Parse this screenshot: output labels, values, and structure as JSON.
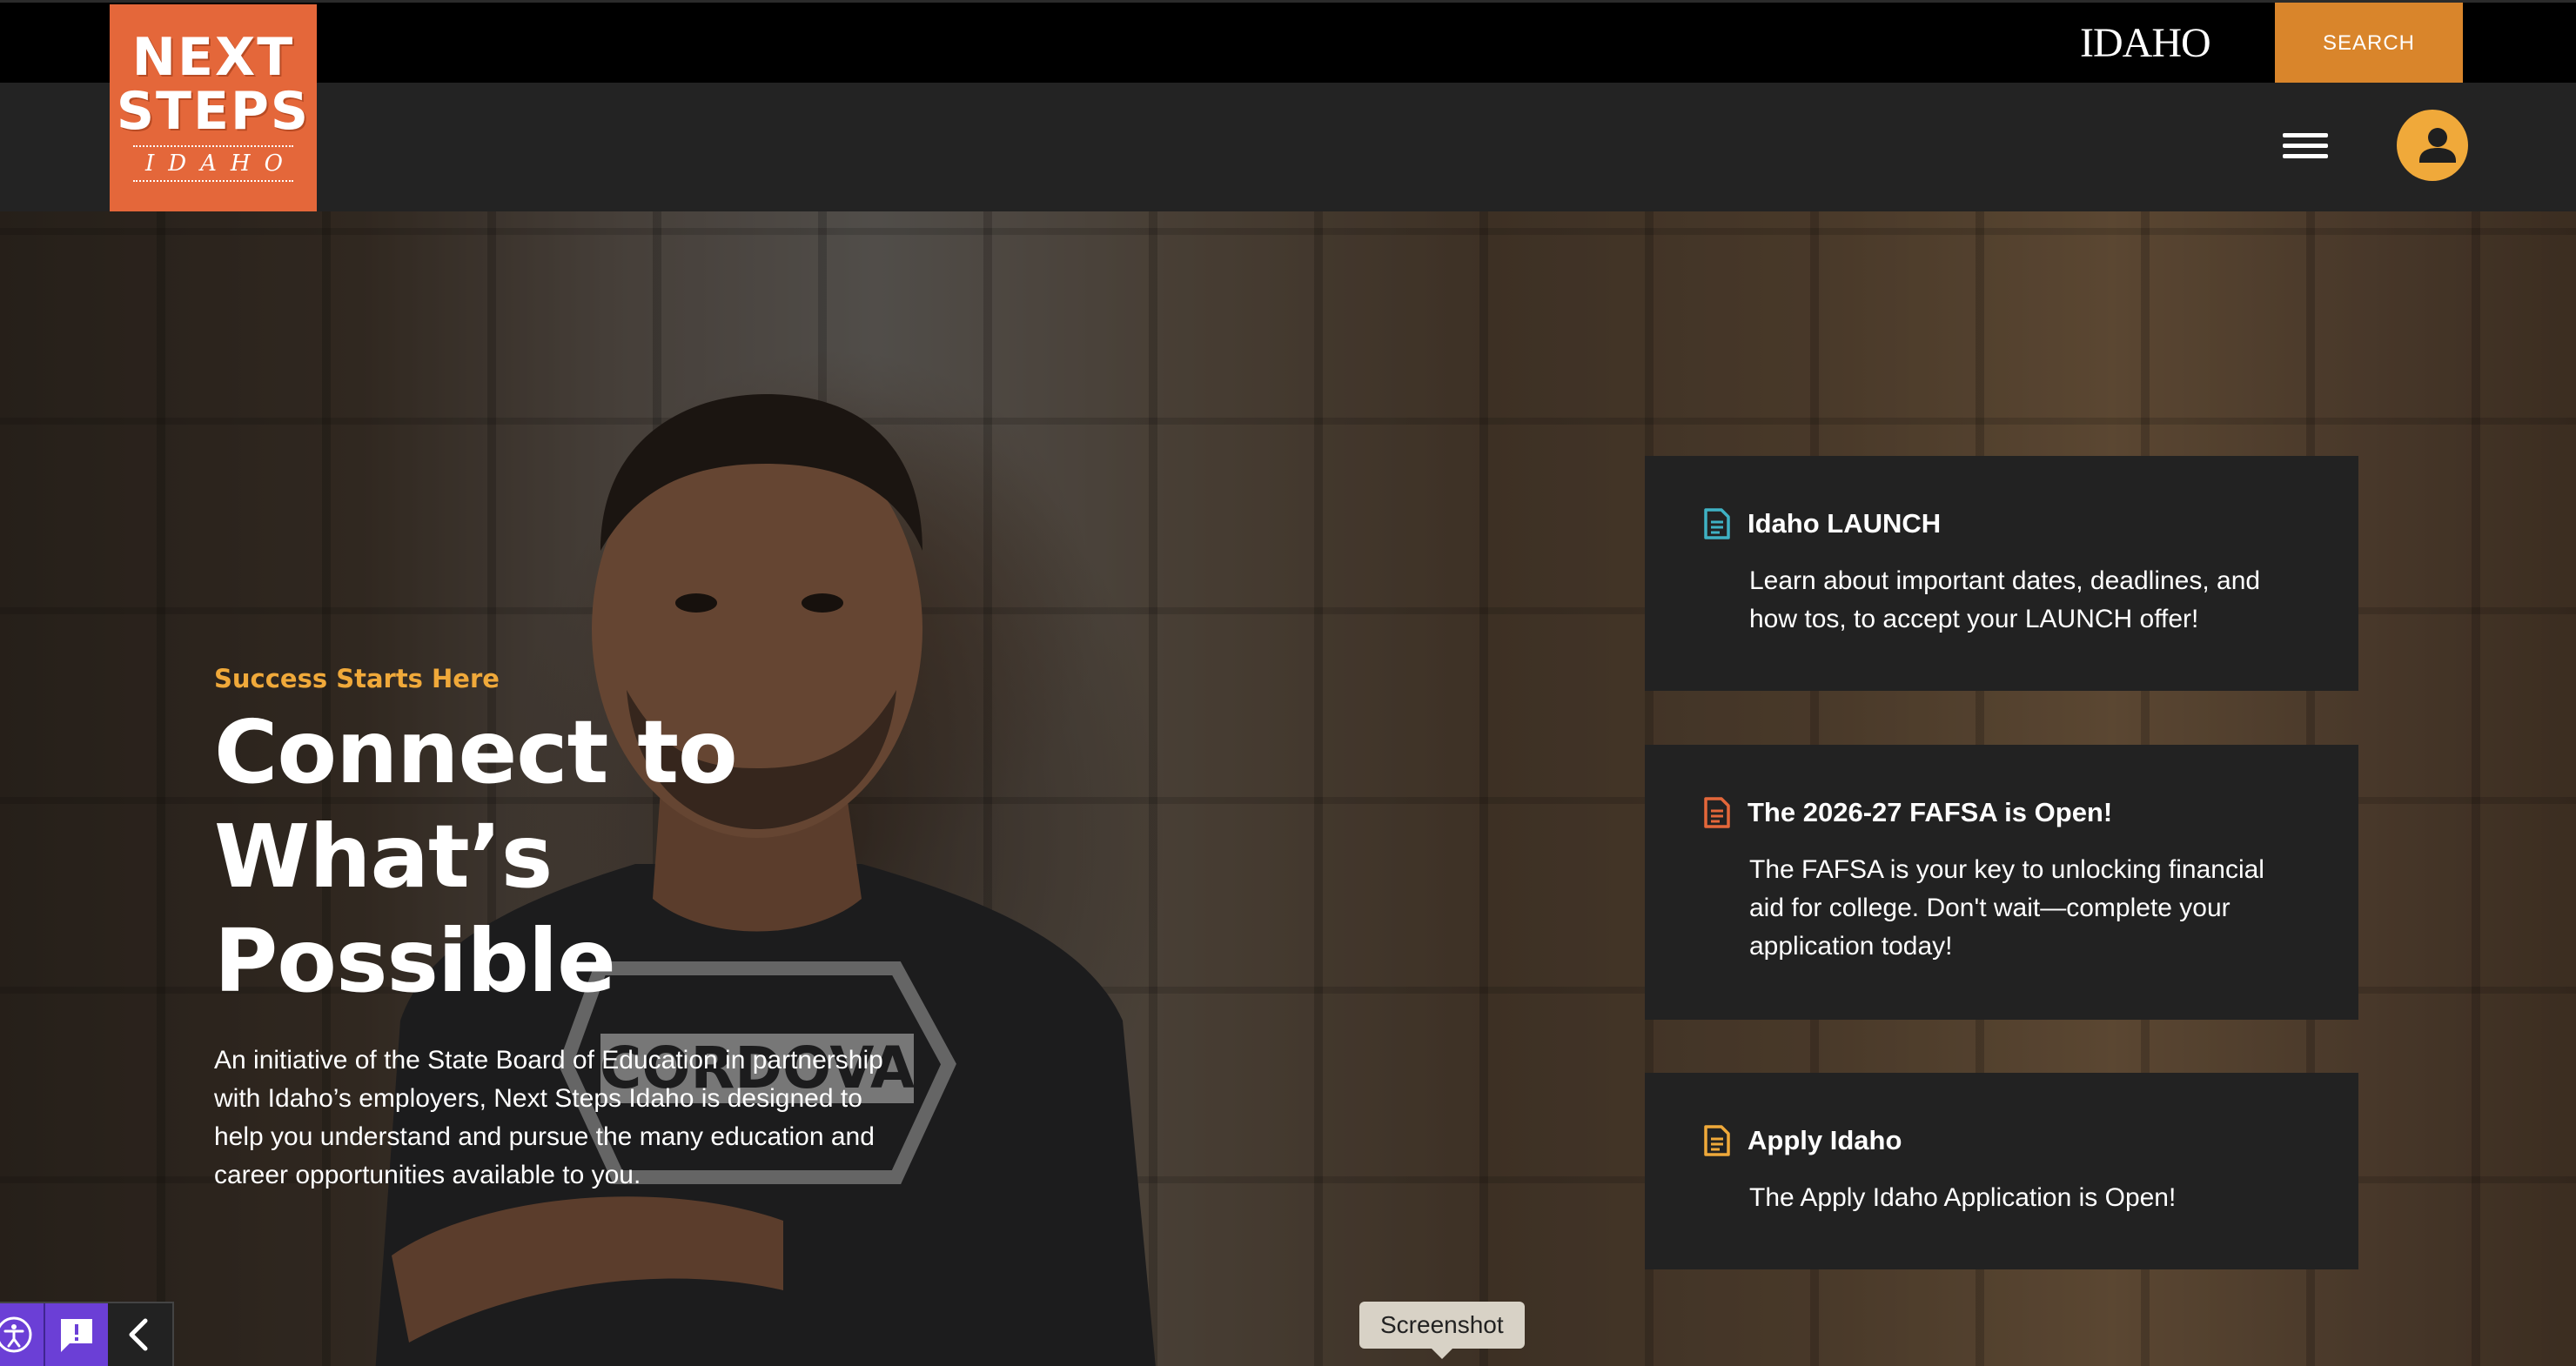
{
  "utility_bar": {
    "state_wordmark": "IDAHO",
    "search_label": "SEARCH"
  },
  "logo": {
    "line1": "NEXT",
    "line2": "STEPS",
    "line3": "IDAHO"
  },
  "hero": {
    "eyebrow": "Success Starts Here",
    "headline_line1": "Connect to",
    "headline_line2": "What’s Possible",
    "intro": "An initiative of the State Board of Education in partnership with Idaho’s employers, Next Steps Idaho is designed to help you understand and pursue the many education and career opportunities available to you."
  },
  "cards": [
    {
      "title": "Idaho LAUNCH",
      "body": "Learn about important dates, deadlines, and how tos, to accept your LAUNCH offer!",
      "icon": "document-icon",
      "icon_color": "#3fb2c4"
    },
    {
      "title": "The 2026-27 FAFSA is Open!",
      "body": "The FAFSA is your key to unlocking financial aid for college. Don't wait—complete your application today!",
      "icon": "document-icon",
      "icon_color": "#e4673a"
    },
    {
      "title": "Apply Idaho",
      "body": "The Apply Idaho Application is Open!",
      "icon": "document-icon",
      "icon_color": "#f0a93a"
    }
  ],
  "widgets": {
    "screenshot_label": "Screenshot"
  },
  "colors": {
    "brand_orange": "#e4673a",
    "search_orange": "#d9852b",
    "accent_gold": "#f0a93a",
    "nav_dark": "#232323",
    "card_dark": "#222222",
    "widget_purple": "#6b3fd6"
  }
}
